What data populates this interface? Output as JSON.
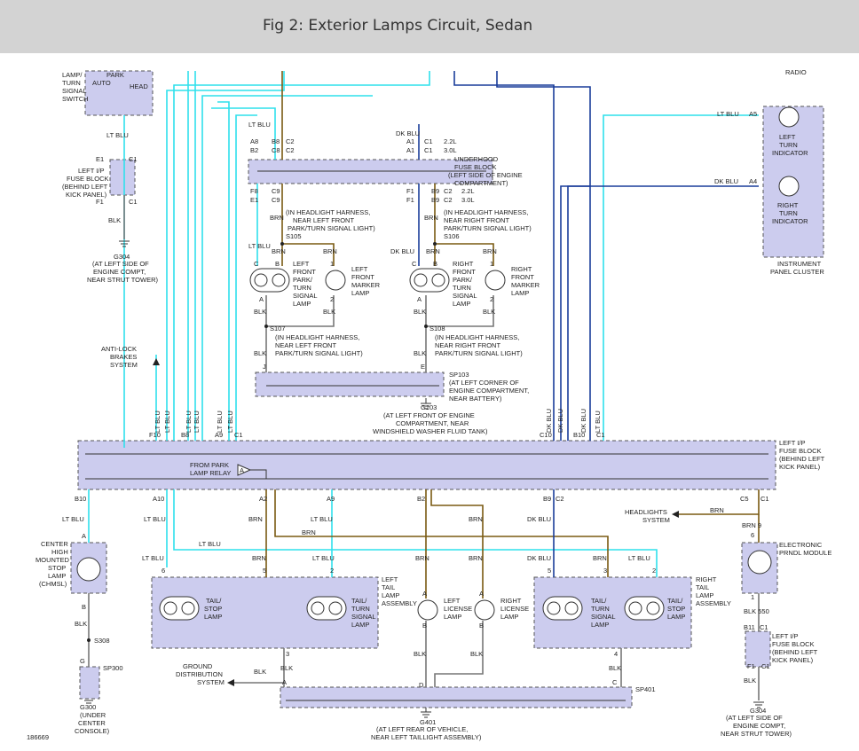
{
  "title": "Fig 2: Exterior Lamps Circuit, Sedan",
  "figure_number": "186669",
  "colors": {
    "title_bg": "#d3d3d3",
    "component_fill": "#ccccee",
    "lt_blu": "#2fe0ec",
    "brn": "#7a5a12",
    "dk_blu": "#1a3d9a",
    "blk": "#777777"
  },
  "wire_colors": {
    "lt_blu": "LT BLU",
    "brn": "BRN",
    "dk_blu": "DK BLU",
    "blk": "BLK",
    "blk550": "BLK 550",
    "brn9": "BRN  9"
  },
  "components": {
    "switch": {
      "l1": "LAMP/",
      "l2": "TURN",
      "l3": "SIGNAL",
      "l4": "SWITCH",
      "park": "PARK",
      "auto": "AUTO",
      "head": "HEAD"
    },
    "radio": "RADIO",
    "fb_left": {
      "l1": "LEFT I/P",
      "l2": "FUSE BLOCK",
      "l3": "(BEHIND LEFT",
      "l4": "KICK PANEL)"
    },
    "g304": {
      "name": "G304",
      "l1": "(AT LEFT SIDE OF",
      "l2": "ENGINE COMPT,",
      "l3": "NEAR STRUT TOWER)"
    },
    "g304b": {
      "name": "G304",
      "l1": "(AT LEFT SIDE OF",
      "l2": "ENGINE COMPT,",
      "l3": "NEAR STRUT TOWER)"
    },
    "underhood": {
      "l1": "UNDERHOOD",
      "l2": "FUSE BLOCK",
      "l3": "(LEFT SIDE OF ENGINE",
      "l4": "COMPARTMENT)"
    },
    "cluster": {
      "l1": "INSTRUMENT",
      "l2": "PANEL CLUSTER",
      "lti1": "LEFT",
      "lti2": "TURN",
      "lti3": "INDICATOR",
      "rti1": "RIGHT",
      "rti2": "TURN",
      "rti3": "INDICATOR"
    },
    "s105": {
      "name": "S105",
      "l1": "(IN HEADLIGHT HARNESS,",
      "l2": "NEAR LEFT FRONT",
      "l3": "PARK/TURN SIGNAL LIGHT)"
    },
    "s106": {
      "name": "S106",
      "l1": "(IN HEADLIGHT HARNESS,",
      "l2": "NEAR RIGHT FRONT",
      "l3": "PARK/TURN SIGNAL LIGHT)"
    },
    "s107": {
      "name": "S107",
      "l1": "(IN HEADLIGHT HARNESS,",
      "l2": "NEAR LEFT FRONT",
      "l3": "PARK/TURN SIGNAL LIGHT)"
    },
    "s108": {
      "name": "S108",
      "l1": "(IN HEADLIGHT HARNESS,",
      "l2": "NEAR RIGHT FRONT",
      "l3": "PARK/TURN SIGNAL LIGHT)"
    },
    "lf_park": {
      "l1": "LEFT",
      "l2": "FRONT",
      "l3": "PARK/",
      "l4": "TURN",
      "l5": "SIGNAL",
      "l6": "LAMP"
    },
    "lf_marker": {
      "l1": "LEFT",
      "l2": "FRONT",
      "l3": "MARKER",
      "l4": "LAMP"
    },
    "rf_park": {
      "l1": "RIGHT",
      "l2": "FRONT",
      "l3": "PARK/",
      "l4": "TURN",
      "l5": "SIGNAL",
      "l6": "LAMP"
    },
    "rf_marker": {
      "l1": "RIGHT",
      "l2": "FRONT",
      "l3": "MARKER",
      "l4": "LAMP"
    },
    "sp103": {
      "name": "SP103",
      "l1": "(AT LEFT CORNER OF",
      "l2": "ENGINE COMPARTMENT,",
      "l3": "NEAR BATTERY)"
    },
    "g103": {
      "name": "G103",
      "l1": "(AT LEFT FRONT OF ENGINE",
      "l2": "COMPARTMENT, NEAR",
      "l3": "WINDSHIELD WASHER FLUID TANK)"
    },
    "abs": {
      "l1": "ANTI-LOCK",
      "l2": "BRAKES",
      "l3": "SYSTEM"
    },
    "ip_fb": {
      "l1": "LEFT I/P",
      "l2": "FUSE BLOCK",
      "l3": "(BEHIND LEFT",
      "l4": "KICK PANEL)",
      "relay1": "FROM PARK",
      "relay2": "LAMP RELAY",
      "relay_tag": "A"
    },
    "chmsl": {
      "l1": "CENTER",
      "l2": "HIGH",
      "l3": "MOUNTED",
      "l4": "STOP",
      "l5": "LAMP",
      "l6": "(CHMSL)"
    },
    "s308": "S308",
    "sp300": "SP300",
    "g300": {
      "name": "G300",
      "l1": "(UNDER",
      "l2": "CENTER",
      "l3": "CONSOLE)"
    },
    "left_tail": {
      "l1": "LEFT",
      "l2": "TAIL",
      "l3": "LAMP",
      "l4": "ASSEMBLY",
      "tail_stop1": "TAIL/",
      "tail_stop2": "STOP",
      "tail_stop3": "LAMP",
      "tail_turn1": "TAIL/",
      "tail_turn2": "TURN",
      "tail_turn3": "SIGNAL",
      "tail_turn4": "LAMP"
    },
    "right_tail": {
      "l1": "RIGHT",
      "l2": "TAIL",
      "l3": "LAMP",
      "l4": "ASSEMBLY",
      "tail_turn1": "TAIL/",
      "tail_turn2": "TURN",
      "tail_turn3": "SIGNAL",
      "tail_turn4": "LAMP",
      "tail_stop1": "TAIL/",
      "tail_stop2": "STOP",
      "tail_stop3": "LAMP"
    },
    "left_license": {
      "l1": "LEFT",
      "l2": "LICENSE",
      "l3": "LAMP"
    },
    "right_license": {
      "l1": "RIGHT",
      "l2": "LICENSE",
      "l3": "LAMP"
    },
    "ground_dist": {
      "l1": "GROUND",
      "l2": "DISTRIBUTION",
      "l3": "SYSTEM"
    },
    "headlights": {
      "l1": "HEADLIGHTS",
      "l2": "SYSTEM"
    },
    "prndl": {
      "l1": "ELECTRONIC",
      "l2": "PRNDL MODULE"
    },
    "sp401": "SP401",
    "g401": {
      "name": "G401",
      "l1": "(AT LEFT REAR OF VEHICLE,",
      "l2": "NEAR LEFT TAILLIGHT ASSEMBLY)"
    }
  },
  "terminals": {
    "E1": "E1",
    "F1": "F1",
    "C1": "C1",
    "C2": "C2",
    "A8": "A8",
    "B8": "B8",
    "B2": "B2",
    "C8": "C8",
    "A1": "A1",
    "F1b": "F1",
    "B9": "B9",
    "F8": "F8",
    "C9": "C9",
    "E1b": "E1",
    "A5": "A5",
    "A4": "A4",
    "v22": "2.2L",
    "v30": "3.0L",
    "pA": "A",
    "pB": "B",
    "pC": "C",
    "p1": "1",
    "p2": "2",
    "p3": "3",
    "p4": "4",
    "p5": "5",
    "p6": "6",
    "p9": "9",
    "pJ": "J",
    "pE": "E",
    "pD": "D",
    "pG": "G",
    "F10": "F10",
    "B8b": "B8",
    "A9": "A9",
    "C10": "C10",
    "B10": "B10",
    "B10b": "B10",
    "A10": "A10",
    "A2": "A2",
    "A9b": "A9",
    "B2b": "B2",
    "B9b": "B9",
    "C2b": "C2",
    "C5": "C5",
    "B11": "B11",
    "F1c": "F1"
  }
}
